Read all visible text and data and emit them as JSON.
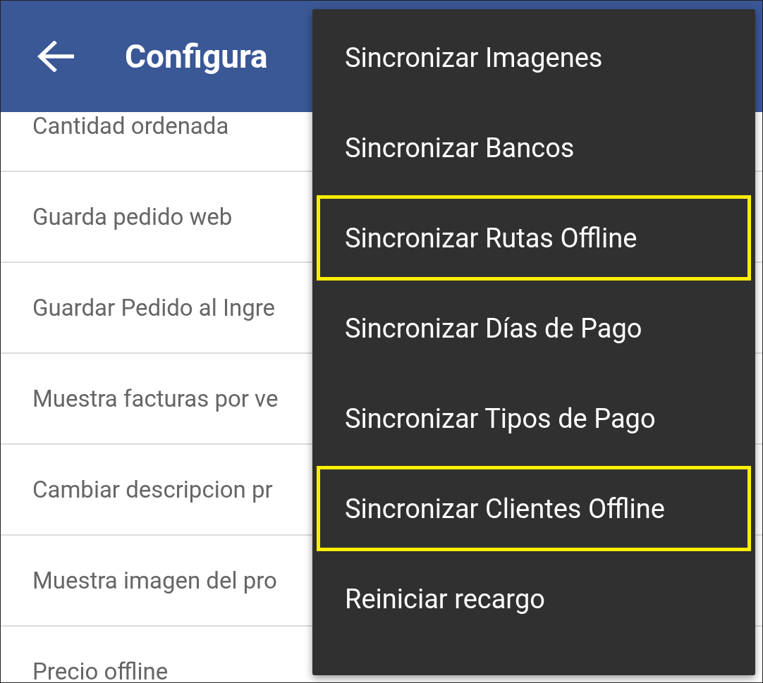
{
  "app_bar": {
    "title": "Configura"
  },
  "settings": [
    {
      "label": "Cantidad ordenada"
    },
    {
      "label": "Guarda pedido web"
    },
    {
      "label": "Guardar Pedido al Ingre"
    },
    {
      "label": "Muestra facturas por ve"
    },
    {
      "label": "Cambiar descripcion pr"
    },
    {
      "label": "Muestra imagen del pro"
    },
    {
      "label": "Precio offline"
    }
  ],
  "menu": {
    "items": [
      {
        "label": "Sincronizar Imagenes",
        "highlighted": false
      },
      {
        "label": "Sincronizar Bancos",
        "highlighted": false
      },
      {
        "label": "Sincronizar Rutas Offline",
        "highlighted": true
      },
      {
        "label": "Sincronizar Días de Pago",
        "highlighted": false
      },
      {
        "label": "Sincronizar Tipos de Pago",
        "highlighted": false
      },
      {
        "label": "Sincronizar Clientes Offline",
        "highlighted": true
      },
      {
        "label": "Reiniciar recargo",
        "highlighted": false
      }
    ]
  }
}
